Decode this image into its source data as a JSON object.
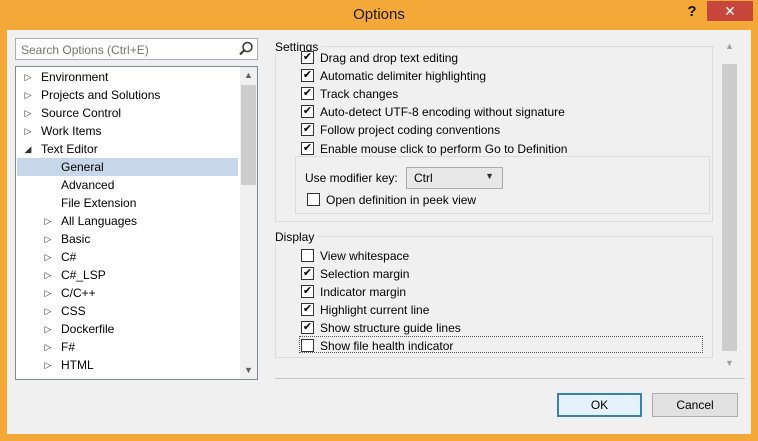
{
  "window": {
    "title": "Options",
    "help_label": "?",
    "close_label": "✕"
  },
  "search": {
    "placeholder": "Search Options (Ctrl+E)"
  },
  "tree": {
    "items": [
      {
        "label": "Environment",
        "level": 0,
        "expandable": true
      },
      {
        "label": "Projects and Solutions",
        "level": 0,
        "expandable": true
      },
      {
        "label": "Source Control",
        "level": 0,
        "expandable": true
      },
      {
        "label": "Work Items",
        "level": 0,
        "expandable": true
      },
      {
        "label": "Text Editor",
        "level": 0,
        "expanded": true
      },
      {
        "label": "General",
        "level": 1,
        "selected": true
      },
      {
        "label": "Advanced",
        "level": 1
      },
      {
        "label": "File Extension",
        "level": 1
      },
      {
        "label": "All Languages",
        "level": 1,
        "expandable": true
      },
      {
        "label": "Basic",
        "level": 1,
        "expandable": true
      },
      {
        "label": "C#",
        "level": 1,
        "expandable": true
      },
      {
        "label": "C#_LSP",
        "level": 1,
        "expandable": true
      },
      {
        "label": "C/C++",
        "level": 1,
        "expandable": true
      },
      {
        "label": "CSS",
        "level": 1,
        "expandable": true
      },
      {
        "label": "Dockerfile",
        "level": 1,
        "expandable": true
      },
      {
        "label": "F#",
        "level": 1,
        "expandable": true
      },
      {
        "label": "HTML",
        "level": 1,
        "expandable": true
      }
    ]
  },
  "settings": {
    "title": "Settings",
    "options": [
      {
        "label": "Drag and drop text editing",
        "checked": true
      },
      {
        "label": "Automatic delimiter highlighting",
        "checked": true
      },
      {
        "label": "Track changes",
        "checked": true
      },
      {
        "label": "Auto-detect UTF-8 encoding without signature",
        "checked": true
      },
      {
        "label": "Follow project coding conventions",
        "checked": true
      },
      {
        "label": "Enable mouse click to perform Go to Definition",
        "checked": true
      }
    ],
    "modifier_key_label": "Use modifier key:",
    "modifier_key_value": "Ctrl",
    "peek_label": "Open definition in peek view",
    "peek_checked": false
  },
  "display": {
    "title": "Display",
    "options": [
      {
        "label": "View whitespace",
        "checked": false
      },
      {
        "label": "Selection margin",
        "checked": true
      },
      {
        "label": "Indicator margin",
        "checked": true
      },
      {
        "label": "Highlight current line",
        "checked": true
      },
      {
        "label": "Show structure guide lines",
        "checked": true
      },
      {
        "label": "Show file health indicator",
        "checked": false
      }
    ]
  },
  "buttons": {
    "ok": "OK",
    "cancel": "Cancel"
  },
  "colors": {
    "frame": "#f3a838",
    "close": "#c7463c",
    "selection": "#c8d6ea"
  }
}
